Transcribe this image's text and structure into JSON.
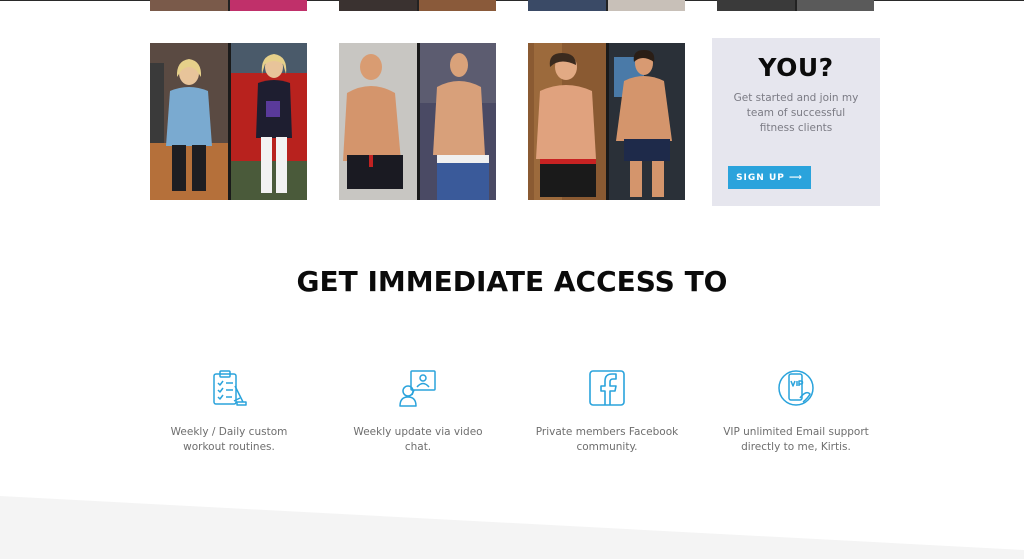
{
  "signup_card": {
    "title": "YOU?",
    "text": "Get started and join my team of successful fitness clients",
    "button_label": "SIGN UP ⟶"
  },
  "section": {
    "heading": "GET IMMEDIATE ACCESS TO"
  },
  "features": [
    {
      "icon": "clipboard-checklist-icon",
      "text": "Weekly / Daily custom workout routines."
    },
    {
      "icon": "video-chat-icon",
      "text": "Weekly update via video chat."
    },
    {
      "icon": "facebook-icon",
      "text": "Private members Facebook community."
    },
    {
      "icon": "vip-phone-icon",
      "text": "VIP unlimited Email support directly to me, Kirtis."
    }
  ],
  "colors": {
    "accent": "#2aa3dc",
    "card_bg": "#e6e6ee",
    "heading": "#0b0b0b",
    "body_text": "#6e6e6e"
  }
}
